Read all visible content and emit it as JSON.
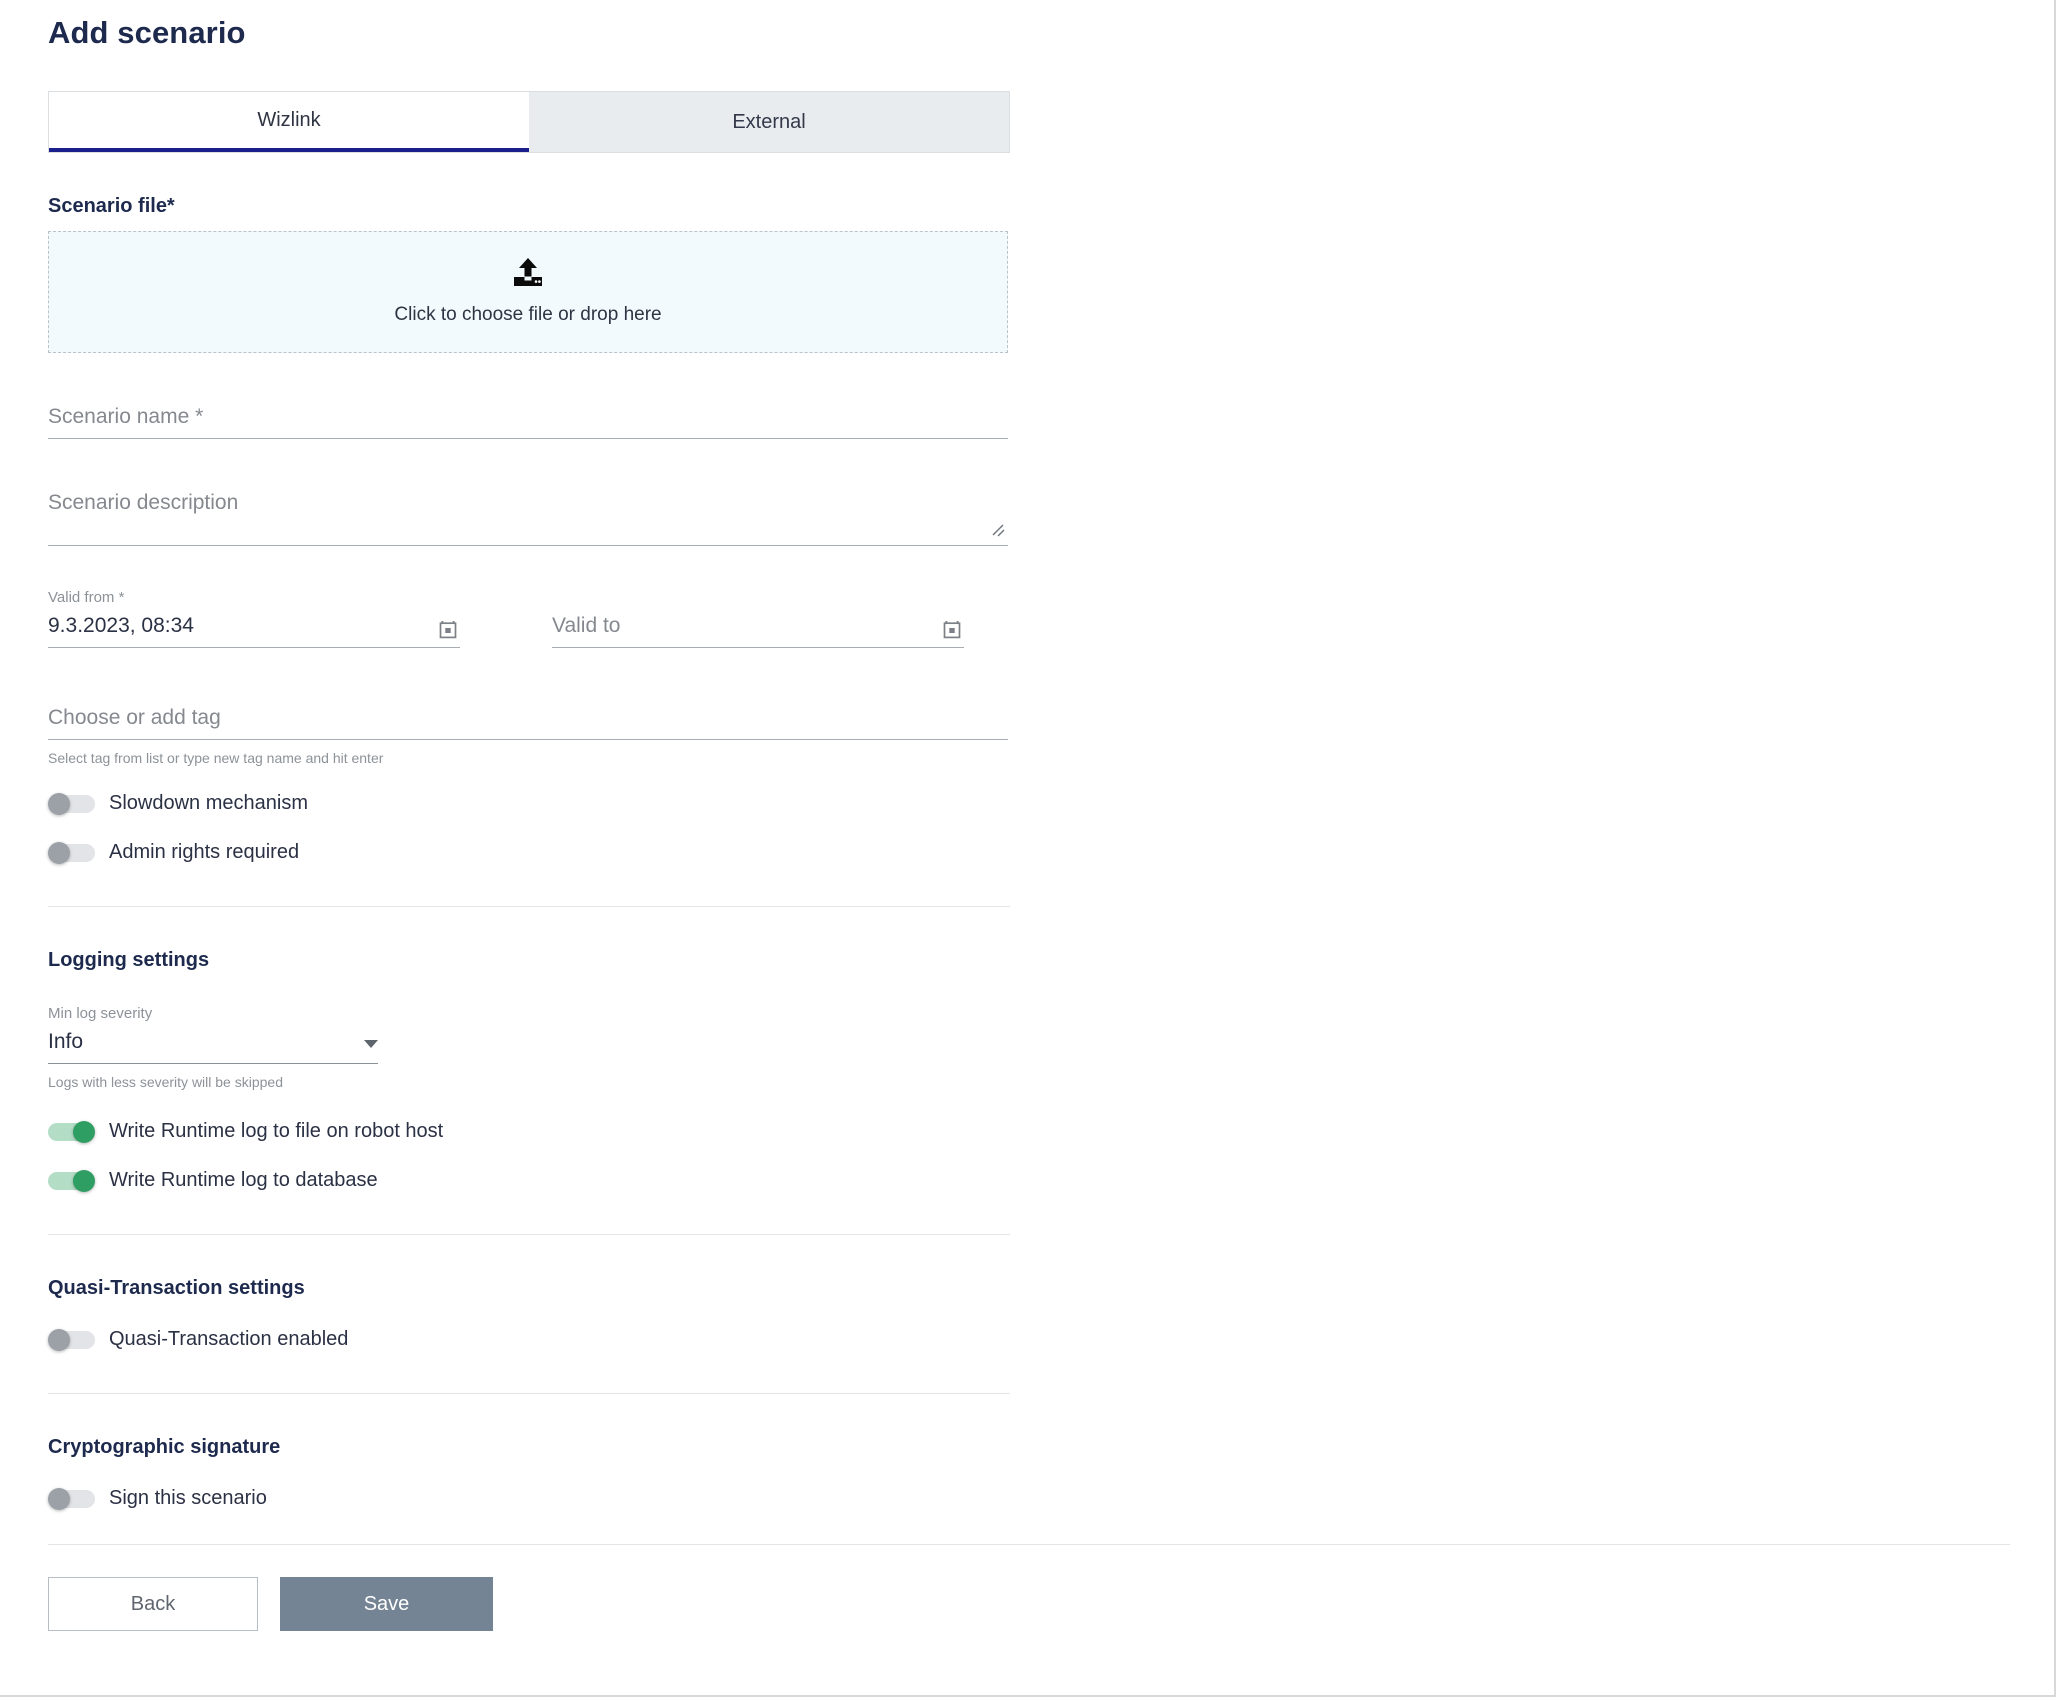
{
  "header": {
    "title": "Add scenario"
  },
  "tabs": [
    {
      "label": "Wizlink",
      "active": true,
      "name": "tab-wizlink"
    },
    {
      "label": "External",
      "active": false,
      "name": "tab-external"
    }
  ],
  "scenario_file": {
    "section_label": "Scenario file*",
    "dropzone_text": "Click to choose file or drop here",
    "upload_icon": "upload-icon"
  },
  "fields": {
    "scenario_name": {
      "placeholder": "Scenario name *",
      "value": ""
    },
    "scenario_description": {
      "placeholder": "Scenario description",
      "value": ""
    },
    "valid_from": {
      "label": "Valid from *",
      "value": "9.3.2023, 08:34",
      "calendar_icon": "calendar-icon"
    },
    "valid_to": {
      "placeholder": "Valid to",
      "value": "",
      "calendar_icon": "calendar-icon"
    },
    "tag": {
      "placeholder": "Choose or add tag",
      "value": "",
      "hint": "Select tag from list or type new tag name and hit enter"
    }
  },
  "general_toggles": [
    {
      "label": "Slowdown mechanism",
      "on": false,
      "name": "toggle-slowdown-mechanism"
    },
    {
      "label": "Admin rights required",
      "on": false,
      "name": "toggle-admin-rights-required"
    }
  ],
  "logging": {
    "section_label": "Logging settings",
    "min_log_severity": {
      "label": "Min log severity",
      "value": "Info",
      "hint": "Logs with less severity will be skipped",
      "options": [
        "Info"
      ]
    },
    "toggles": [
      {
        "label": "Write Runtime log to file on robot host",
        "on": true,
        "name": "toggle-write-runtime-log-to-file"
      },
      {
        "label": "Write Runtime log to database",
        "on": true,
        "name": "toggle-write-runtime-log-to-database"
      }
    ]
  },
  "quasi_transaction": {
    "section_label": "Quasi-Transaction settings",
    "toggles": [
      {
        "label": "Quasi-Transaction enabled",
        "on": false,
        "name": "toggle-quasi-transaction-enabled"
      }
    ]
  },
  "cryptographic_signature": {
    "section_label": "Cryptographic signature",
    "toggles": [
      {
        "label": "Sign this scenario",
        "on": false,
        "name": "toggle-sign-this-scenario"
      }
    ]
  },
  "footer": {
    "back_label": "Back",
    "save_label": "Save"
  },
  "colors": {
    "accent_tab_underline": "#1a1f8c",
    "title": "#1d2a4d",
    "toggle_on": "#2f9e63",
    "toggle_on_track": "#b4ddc6",
    "toggle_off": "#9ba1a7",
    "save_button": "#748494",
    "dropzone_bg": "#f2fafd"
  }
}
